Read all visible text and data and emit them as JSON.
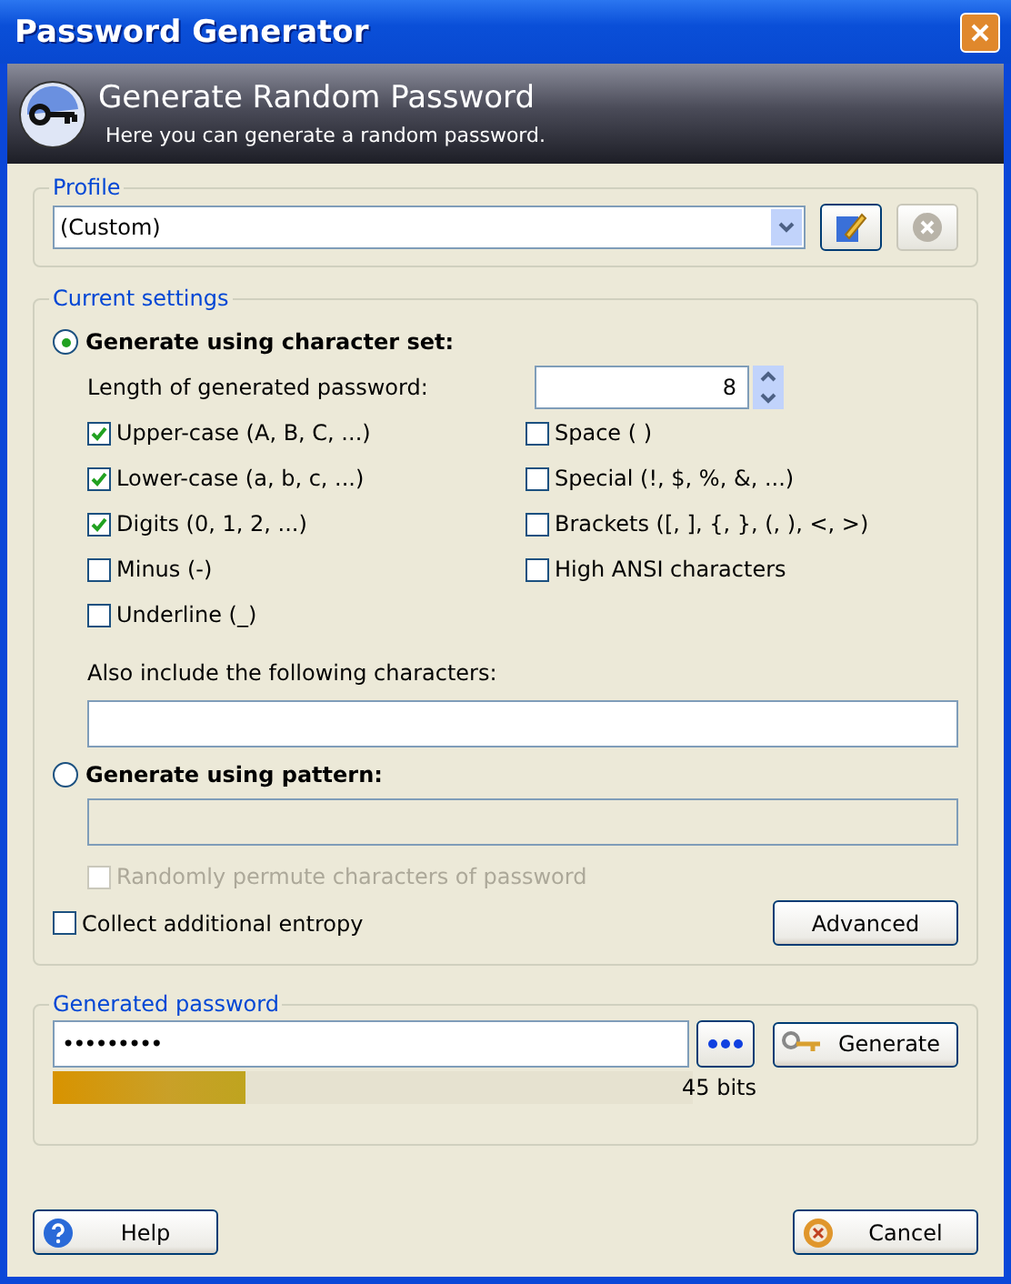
{
  "window": {
    "title": "Password Generator"
  },
  "banner": {
    "title": "Generate Random Password",
    "subtitle": "Here you can generate a random password."
  },
  "profile": {
    "label": "Profile",
    "value": "(Custom)"
  },
  "settings": {
    "label": "Current settings",
    "modes": [
      {
        "label": "Generate using character set:",
        "selected": true
      },
      {
        "label": "Generate using pattern:",
        "selected": false
      }
    ],
    "length": {
      "label": "Length of generated password:",
      "value": "8"
    },
    "charsets_left": [
      {
        "label": "Upper-case (A, B, C, ...)",
        "checked": true
      },
      {
        "label": "Lower-case (a, b, c, ...)",
        "checked": true
      },
      {
        "label": "Digits (0, 1, 2, ...)",
        "checked": true
      },
      {
        "label": "Minus (-)",
        "checked": false
      },
      {
        "label": "Underline (_)",
        "checked": false
      }
    ],
    "charsets_right": [
      {
        "label": "Space ( )",
        "checked": false
      },
      {
        "label": "Special (!, $, %, &, ...)",
        "checked": false
      },
      {
        "label": "Brackets ([, ], {, }, (, ), <, >)",
        "checked": false
      },
      {
        "label": "High ANSI characters",
        "checked": false
      }
    ],
    "include": {
      "label": "Also include the following characters:"
    },
    "permute": {
      "label": "Randomly permute characters of password",
      "checked": false,
      "disabled": true
    },
    "entropy": {
      "label": "Collect additional entropy",
      "checked": false
    },
    "advanced": "Advanced"
  },
  "generated": {
    "label": "Generated password",
    "value": "•••••••••",
    "quality": {
      "level": 0.3
    },
    "bits": "45 bits",
    "generate": "Generate"
  },
  "buttons": [
    {
      "label": "Help",
      "kind": "help"
    },
    {
      "label": "Cancel",
      "kind": "cancel"
    }
  ]
}
